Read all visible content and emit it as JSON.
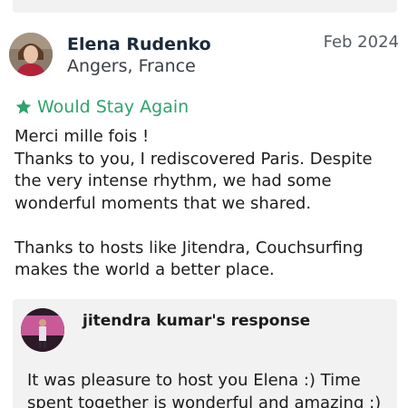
{
  "review": {
    "reviewer_name": "Elena Rudenko",
    "reviewer_location": "Angers, France",
    "date": "Feb 2024",
    "badge_label": "Would Stay Again",
    "text": "Merci mille fois !\nThanks to you, I rediscovered Paris. Despite the very intense rhythm, we had some wonderful moments that we shared.\n\nThanks to hosts like Jitendra, Couchsurfing makes the world a better place."
  },
  "response": {
    "title": "jitendra kumar's response",
    "text": "It was pleasure to host you Elena :)  Time spent together is wonderful and amazing :)"
  },
  "colors": {
    "accent_green": "#2fa36b",
    "response_bg": "#f2f2f2"
  },
  "icons": {
    "badge": "star-icon"
  }
}
